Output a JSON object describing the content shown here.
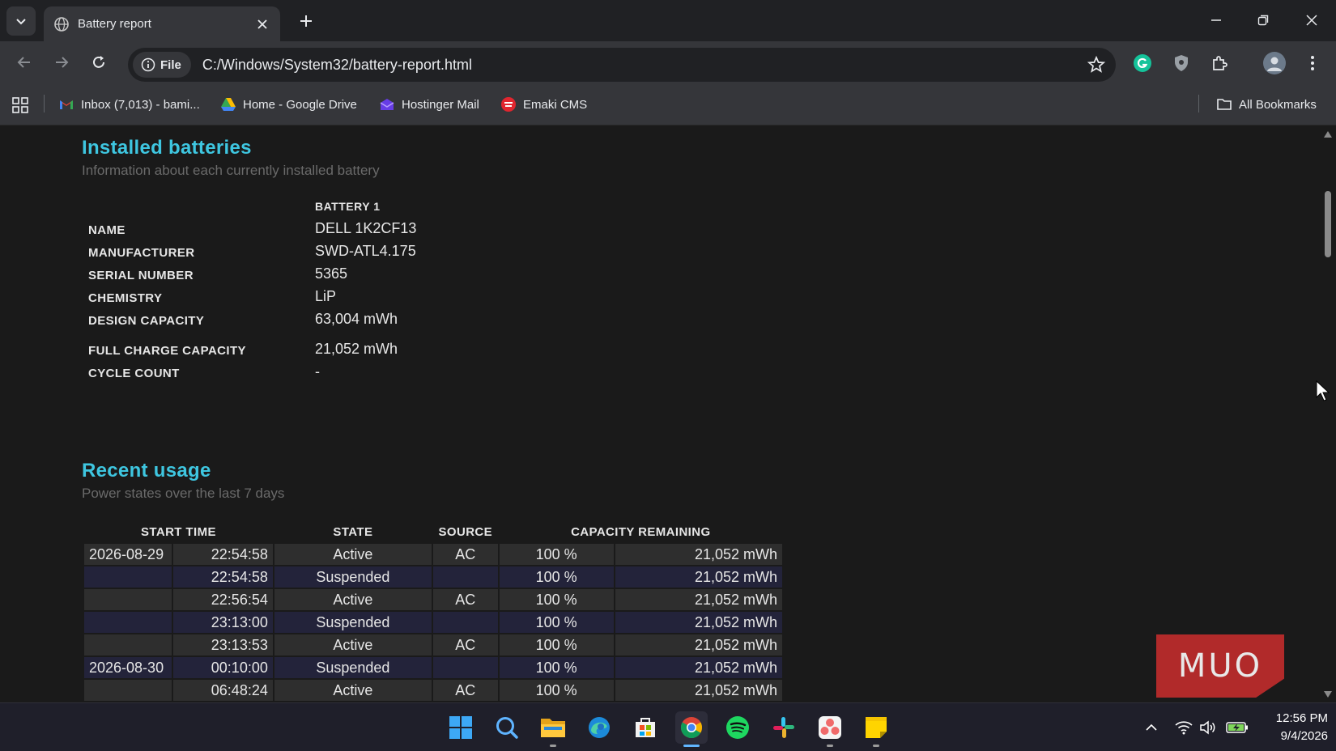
{
  "browser": {
    "tab": {
      "title": "Battery report"
    },
    "omnibox": {
      "site_chip": "File",
      "url": "C:/Windows/System32/battery-report.html"
    },
    "bookmarks": [
      {
        "label": "Inbox (7,013) - bami...",
        "icon": "gmail-icon"
      },
      {
        "label": "Home - Google Drive",
        "icon": "google-drive-icon"
      },
      {
        "label": "Hostinger Mail",
        "icon": "hostinger-icon"
      },
      {
        "label": "Emaki CMS",
        "icon": "emaki-icon"
      }
    ],
    "all_bookmarks": "All Bookmarks"
  },
  "installed": {
    "title": "Installed batteries",
    "subtitle": "Information about each currently installed battery",
    "column": "BATTERY 1",
    "rows": [
      {
        "label": "NAME",
        "value": "DELL 1K2CF13"
      },
      {
        "label": "MANUFACTURER",
        "value": "SWD-ATL4.175"
      },
      {
        "label": "SERIAL NUMBER",
        "value": "5365"
      },
      {
        "label": "CHEMISTRY",
        "value": "LiP"
      },
      {
        "label": "DESIGN CAPACITY",
        "value": "63,004 mWh"
      },
      {
        "label": "FULL CHARGE CAPACITY",
        "value": "21,052 mWh"
      },
      {
        "label": "CYCLE COUNT",
        "value": "-"
      }
    ]
  },
  "usage": {
    "title": "Recent usage",
    "subtitle": "Power states over the last 7 days",
    "headers": {
      "start": "START TIME",
      "state": "STATE",
      "source": "SOURCE",
      "capacity": "CAPACITY REMAINING"
    },
    "rows": [
      {
        "date": "2026-08-29",
        "time": "22:54:58",
        "state": "Active",
        "source": "AC",
        "pct": "100 %",
        "mwh": "21,052 mWh"
      },
      {
        "date": "",
        "time": "22:54:58",
        "state": "Suspended",
        "source": "",
        "pct": "100 %",
        "mwh": "21,052 mWh"
      },
      {
        "date": "",
        "time": "22:56:54",
        "state": "Active",
        "source": "AC",
        "pct": "100 %",
        "mwh": "21,052 mWh"
      },
      {
        "date": "",
        "time": "23:13:00",
        "state": "Suspended",
        "source": "",
        "pct": "100 %",
        "mwh": "21,052 mWh"
      },
      {
        "date": "",
        "time": "23:13:53",
        "state": "Active",
        "source": "AC",
        "pct": "100 %",
        "mwh": "21,052 mWh"
      },
      {
        "date": "2026-08-30",
        "time": "00:10:00",
        "state": "Suspended",
        "source": "",
        "pct": "100 %",
        "mwh": "21,052 mWh"
      },
      {
        "date": "",
        "time": "06:48:24",
        "state": "Active",
        "source": "AC",
        "pct": "100 %",
        "mwh": "21,052 mWh"
      }
    ]
  },
  "watermark": "MUO",
  "taskbar": {
    "apps": [
      "windows-start-icon",
      "search-icon",
      "file-explorer-icon",
      "edge-icon",
      "microsoft-store-icon",
      "chrome-icon",
      "spotify-icon",
      "slack-icon",
      "asana-icon",
      "sticky-notes-icon"
    ],
    "time": "12:56 PM",
    "date": "9/4/2026"
  },
  "colors": {
    "heading": "#3ec6e0",
    "row_odd": "#2e2e2e",
    "row_even": "#23233a",
    "watermark": "#b12a2a"
  }
}
